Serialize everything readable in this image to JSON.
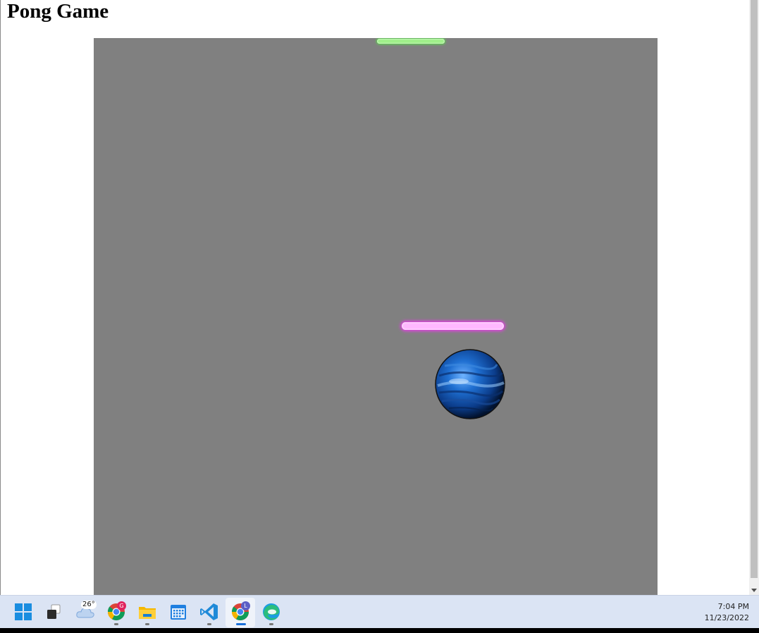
{
  "page": {
    "title": "Pong Game"
  },
  "game": {
    "background": "#808080",
    "top_paddle_color": "#9ff08a",
    "bottom_paddle_color": "#ffb8ff",
    "ball_color": "#1e5fb8"
  },
  "taskbar": {
    "items": [
      {
        "name": "start",
        "icon": "windows-logo-icon"
      },
      {
        "name": "task-view",
        "icon": "task-view-icon"
      },
      {
        "name": "weather",
        "icon": "cloud-icon",
        "label": "26°"
      },
      {
        "name": "chrome-profile-g",
        "icon": "chrome-icon",
        "badge": "G"
      },
      {
        "name": "file-explorer",
        "icon": "folder-icon"
      },
      {
        "name": "calendar",
        "icon": "calendar-icon"
      },
      {
        "name": "vscode",
        "icon": "vscode-icon"
      },
      {
        "name": "chrome-profile-l",
        "icon": "chrome-icon",
        "badge": "L",
        "active": true
      },
      {
        "name": "edge",
        "icon": "edge-icon"
      }
    ],
    "clock": {
      "time": "7:04 PM",
      "date": "11/23/2022"
    }
  }
}
